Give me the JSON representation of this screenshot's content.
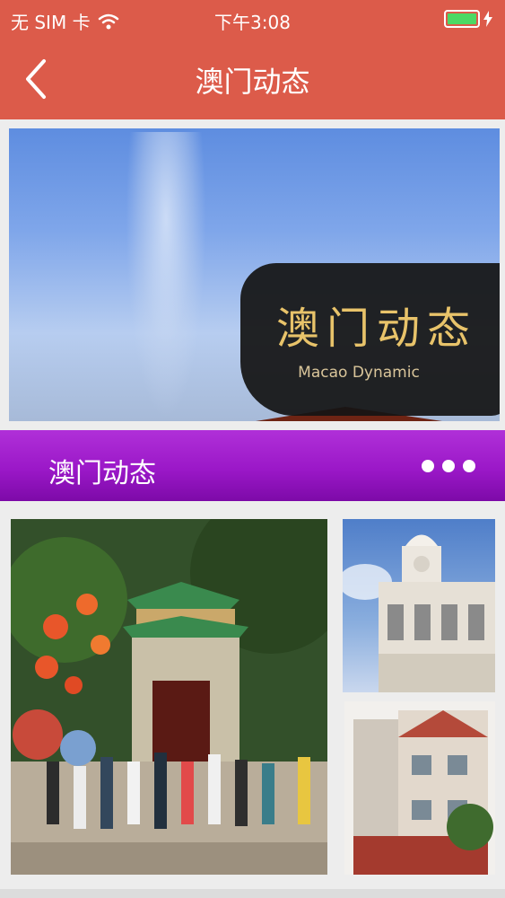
{
  "status_bar": {
    "carrier": "无 SIM 卡",
    "time": "下午3:08",
    "battery_level": 1.0
  },
  "nav": {
    "title": "澳门动态",
    "back_icon": "chevron-left-icon"
  },
  "banner": {
    "title": "澳门动态",
    "subtitle": "Macao Dynamic"
  },
  "section": {
    "title": "澳门动态",
    "more_icon": "more-dots-icon"
  },
  "colors": {
    "nav_background": "#dc5b4a",
    "section_background": "#9b18c8",
    "page_background": "#ededed"
  }
}
